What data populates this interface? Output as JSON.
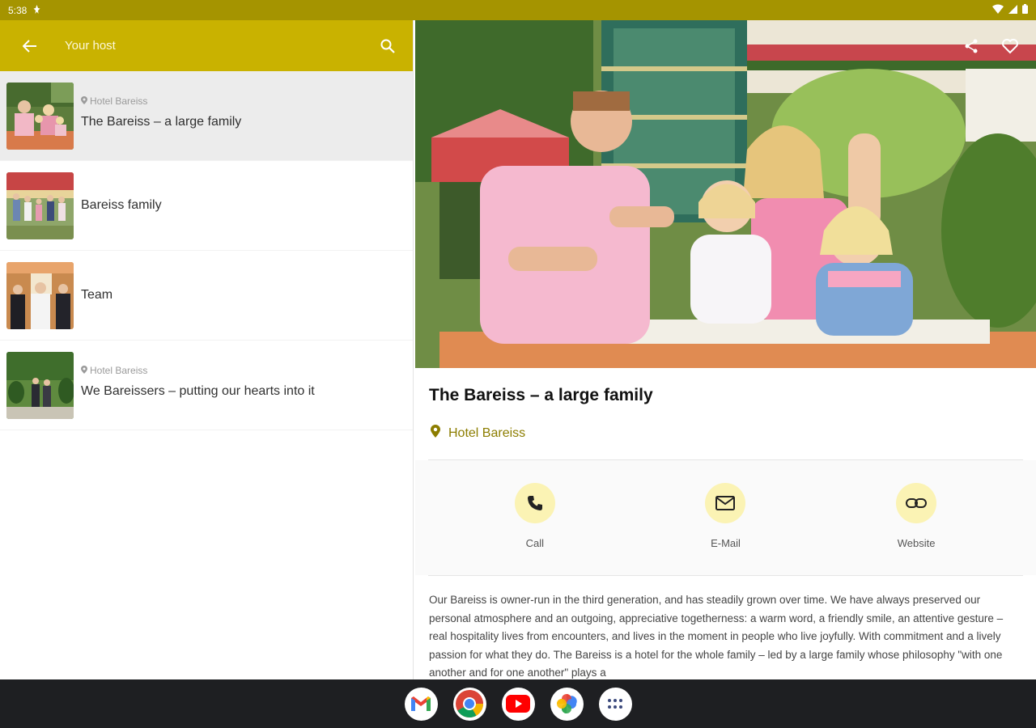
{
  "status_bar": {
    "time": "5:38"
  },
  "app_bar": {
    "title": "Your host"
  },
  "list": [
    {
      "location": "Hotel Bareiss",
      "title": "The Bareiss – a large family",
      "selected": true
    },
    {
      "location": "",
      "title": "Bareiss family",
      "selected": false
    },
    {
      "location": "",
      "title": "Team",
      "selected": false
    },
    {
      "location": "Hotel Bareiss",
      "title": "We Bareissers – putting our hearts into it",
      "selected": false
    }
  ],
  "detail": {
    "title": "The Bareiss – a large family",
    "location": "Hotel Bareiss",
    "actions": {
      "call": "Call",
      "email": "E-Mail",
      "website": "Website"
    },
    "description": "Our Bareiss is owner-run in the third generation, and has steadily grown over time. We have always preserved our personal atmosphere and an outgoing, appreciative togetherness: a warm word, a friendly smile, an attentive gesture – real hospitality lives from encounters, and lives in the moment in people who live joyfully. With commitment and a lively passion for what they do. The Bareiss is a hotel for the whole family – led by a large family whose philosophy \"with one another and for one another\" plays a"
  },
  "colors": {
    "status_bar": "#a59400",
    "app_bar": "#c9b200",
    "accent": "#8c7d00",
    "action_circle": "#fbf3b4"
  },
  "icons": {
    "back": "arrow-left-icon",
    "search": "search-icon",
    "share": "share-icon",
    "favorite": "heart-icon",
    "location": "location-pin-icon",
    "call": "phone-icon",
    "email": "mail-icon",
    "website": "link-icon"
  },
  "dock": [
    "Gmail",
    "Chrome",
    "YouTube",
    "Photos",
    "Apps"
  ]
}
